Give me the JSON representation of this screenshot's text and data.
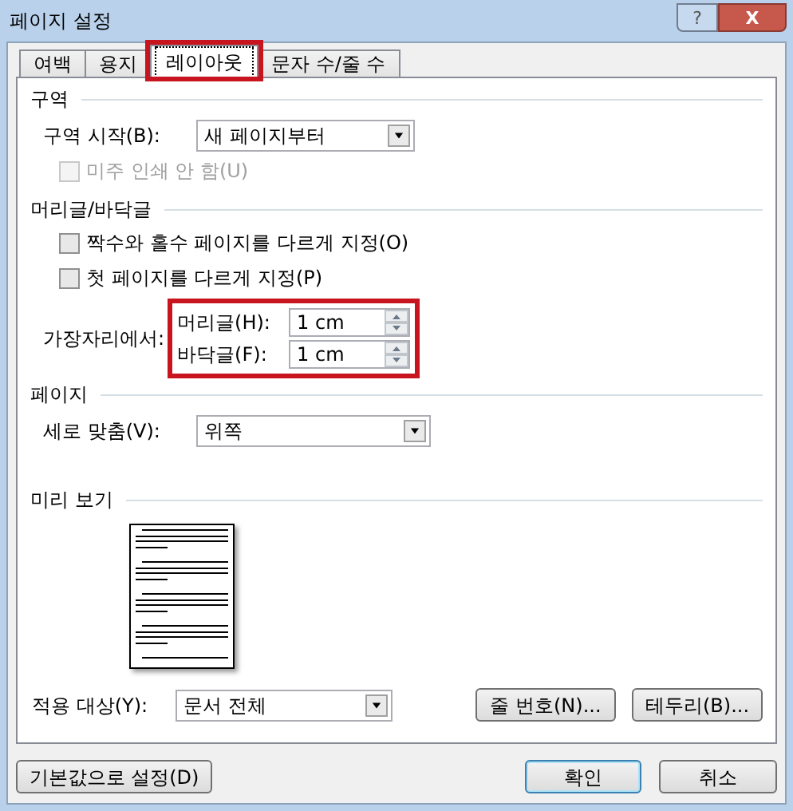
{
  "window": {
    "title": "페이지 설정",
    "help": "?",
    "close": "X"
  },
  "tabs": [
    {
      "label": "여백",
      "selected": false,
      "highlighted": false
    },
    {
      "label": "용지",
      "selected": false,
      "highlighted": false
    },
    {
      "label": "레이아웃",
      "selected": true,
      "highlighted": true
    },
    {
      "label": "문자 수/줄 수",
      "selected": false,
      "highlighted": false
    }
  ],
  "section": {
    "heading": "구역",
    "start_label": "구역 시작(B):",
    "start_value": "새 페이지부터",
    "suppress_endnotes": {
      "label": "미주 인쇄 안 함(U)",
      "checked": false,
      "disabled": true
    }
  },
  "headers_footers": {
    "heading": "머리글/바닥글",
    "options": [
      {
        "label": "짝수와 홀수 페이지를 다르게 지정(O)",
        "checked": false,
        "disabled": false
      },
      {
        "label": "첫 페이지를 다르게 지정(P)",
        "checked": false,
        "disabled": false
      }
    ],
    "from_edge_label": "가장자리에서:",
    "highlighted": true,
    "fields": [
      {
        "label": "머리글(H):",
        "value": "1 cm"
      },
      {
        "label": "바닥글(F):",
        "value": "1 cm"
      }
    ]
  },
  "page": {
    "heading": "페이지",
    "vertical_label": "세로 맞춤(V):",
    "vertical_value": "위쪽"
  },
  "preview": {
    "heading": "미리 보기"
  },
  "apply": {
    "label": "적용 대상(Y):",
    "value": "문서 전체"
  },
  "panel_buttons": [
    "줄 번호(N)...",
    "테두리(B)..."
  ],
  "footer": {
    "default_button": "기본값으로 설정(D)",
    "ok": "확인",
    "cancel": "취소"
  }
}
